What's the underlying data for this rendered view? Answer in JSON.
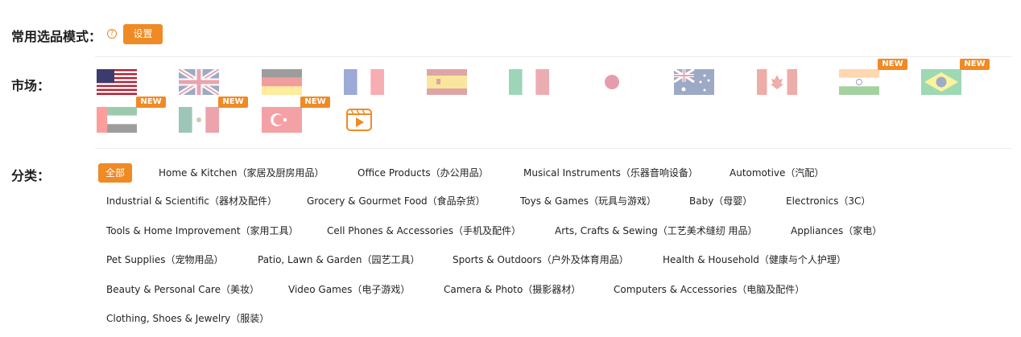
{
  "mode": {
    "label": "常用选品模式：",
    "help_icon": "?",
    "setting_button": "设置"
  },
  "market": {
    "label": "市场：",
    "flags": [
      {
        "id": "us",
        "name": "us-flag",
        "selected": true,
        "new": false
      },
      {
        "id": "uk",
        "name": "uk-flag",
        "selected": false,
        "new": false
      },
      {
        "id": "de",
        "name": "de-flag",
        "selected": false,
        "new": false
      },
      {
        "id": "fr",
        "name": "fr-flag",
        "selected": false,
        "new": false
      },
      {
        "id": "es",
        "name": "es-flag",
        "selected": false,
        "new": false
      },
      {
        "id": "it",
        "name": "it-flag",
        "selected": false,
        "new": false
      },
      {
        "id": "jp",
        "name": "jp-flag",
        "selected": false,
        "new": false
      },
      {
        "id": "au",
        "name": "au-flag",
        "selected": false,
        "new": false
      },
      {
        "id": "ca",
        "name": "ca-flag",
        "selected": false,
        "new": false
      },
      {
        "id": "in",
        "name": "in-flag",
        "selected": false,
        "new": true
      },
      {
        "id": "br",
        "name": "br-flag",
        "selected": false,
        "new": true
      },
      {
        "id": "ae",
        "name": "ae-flag",
        "selected": false,
        "new": true
      },
      {
        "id": "mx",
        "name": "mx-flag",
        "selected": false,
        "new": true
      },
      {
        "id": "tr",
        "name": "tr-flag",
        "selected": false,
        "new": true
      }
    ],
    "new_badge": "NEW",
    "video_icon": "video-play-icon"
  },
  "category": {
    "label": "分类：",
    "items": [
      "全部",
      "Home & Kitchen（家居及厨房用品）",
      "Office Products（办公用品）",
      "Musical Instruments（乐器音响设备）",
      "Automotive（汽配）",
      "Industrial & Scientific（器材及配件）",
      "Grocery & Gourmet Food（食品杂货）",
      "Toys & Games（玩具与游戏）",
      "Baby（母婴）",
      "Electronics（3C）",
      "Tools & Home Improvement（家用工具）",
      "Cell Phones & Accessories（手机及配件）",
      "Arts, Crafts & Sewing（工艺美术缝纫 用品）",
      "Appliances（家电）",
      "Pet Supplies（宠物用品）",
      "Patio, Lawn & Garden（园艺工具）",
      "Sports & Outdoors（户外及体育用品）",
      "Health & Household（健康与个人护理）",
      "Beauty & Personal Care（美妆）",
      "Video Games（电子游戏）",
      "Camera & Photo（摄影器材）",
      "Computers & Accessories（电脑及配件）",
      "Clothing, Shoes & Jewelry（服装）"
    ],
    "active_index": 0
  },
  "colors": {
    "accent": "#f08a24",
    "divider": "#ececec",
    "text": "#222222"
  }
}
